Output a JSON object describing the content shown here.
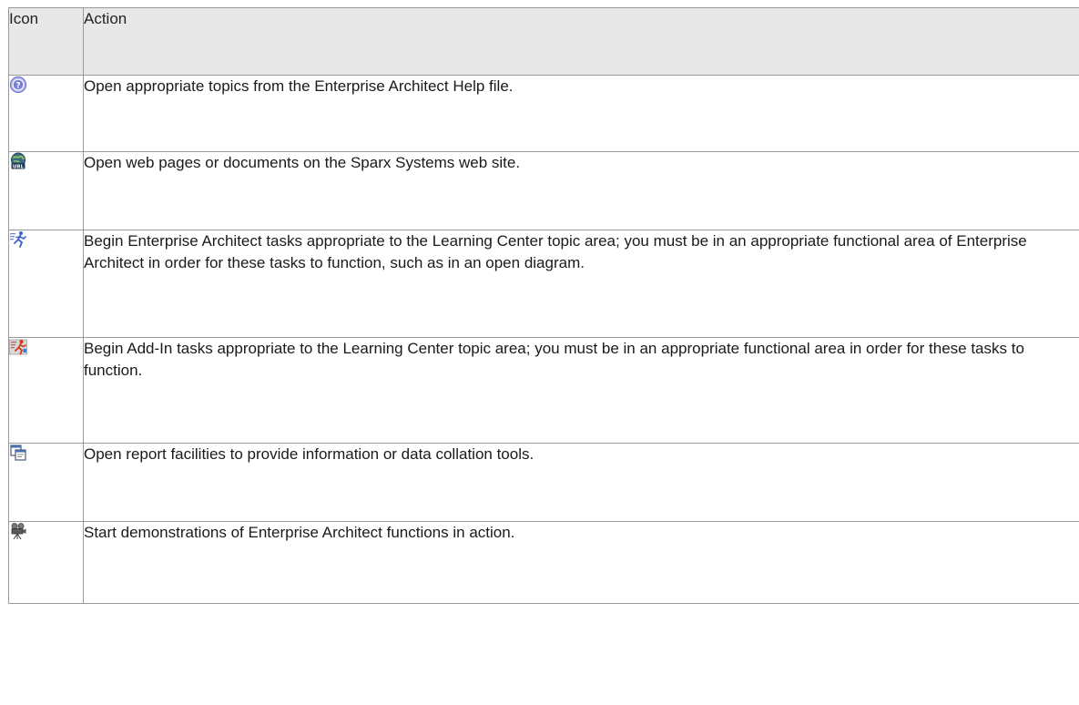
{
  "table": {
    "headers": {
      "icon": "Icon",
      "action": "Action"
    },
    "rows": [
      {
        "icon": "help-icon",
        "action": "Open appropriate topics from the Enterprise Architect Help file."
      },
      {
        "icon": "web-url-icon",
        "action": "Open web pages or documents on the Sparx Systems web site."
      },
      {
        "icon": "ea-task-runner-icon",
        "action": "Begin Enterprise Architect tasks appropriate to the Learning Center topic area; you must be in an appropriate functional area of Enterprise Architect in order for these tasks to function, such as in an open diagram."
      },
      {
        "icon": "add-in-task-runner-icon",
        "action": "Begin Add-In tasks appropriate to the Learning Center topic area; you must be in an appropriate functional area in order for these tasks to function."
      },
      {
        "icon": "report-icon",
        "action": "Open report facilities to provide information or data collation tools."
      },
      {
        "icon": "movie-camera-icon",
        "action": "Start demonstrations of Enterprise Architect functions in action."
      }
    ]
  },
  "colors": {
    "header_bg": "#e8e8e8",
    "border": "#9a9a9a",
    "help_icon": "#7b7fd6",
    "runner_blue": "#3a5fcf",
    "runner_red": "#d63a1c"
  }
}
